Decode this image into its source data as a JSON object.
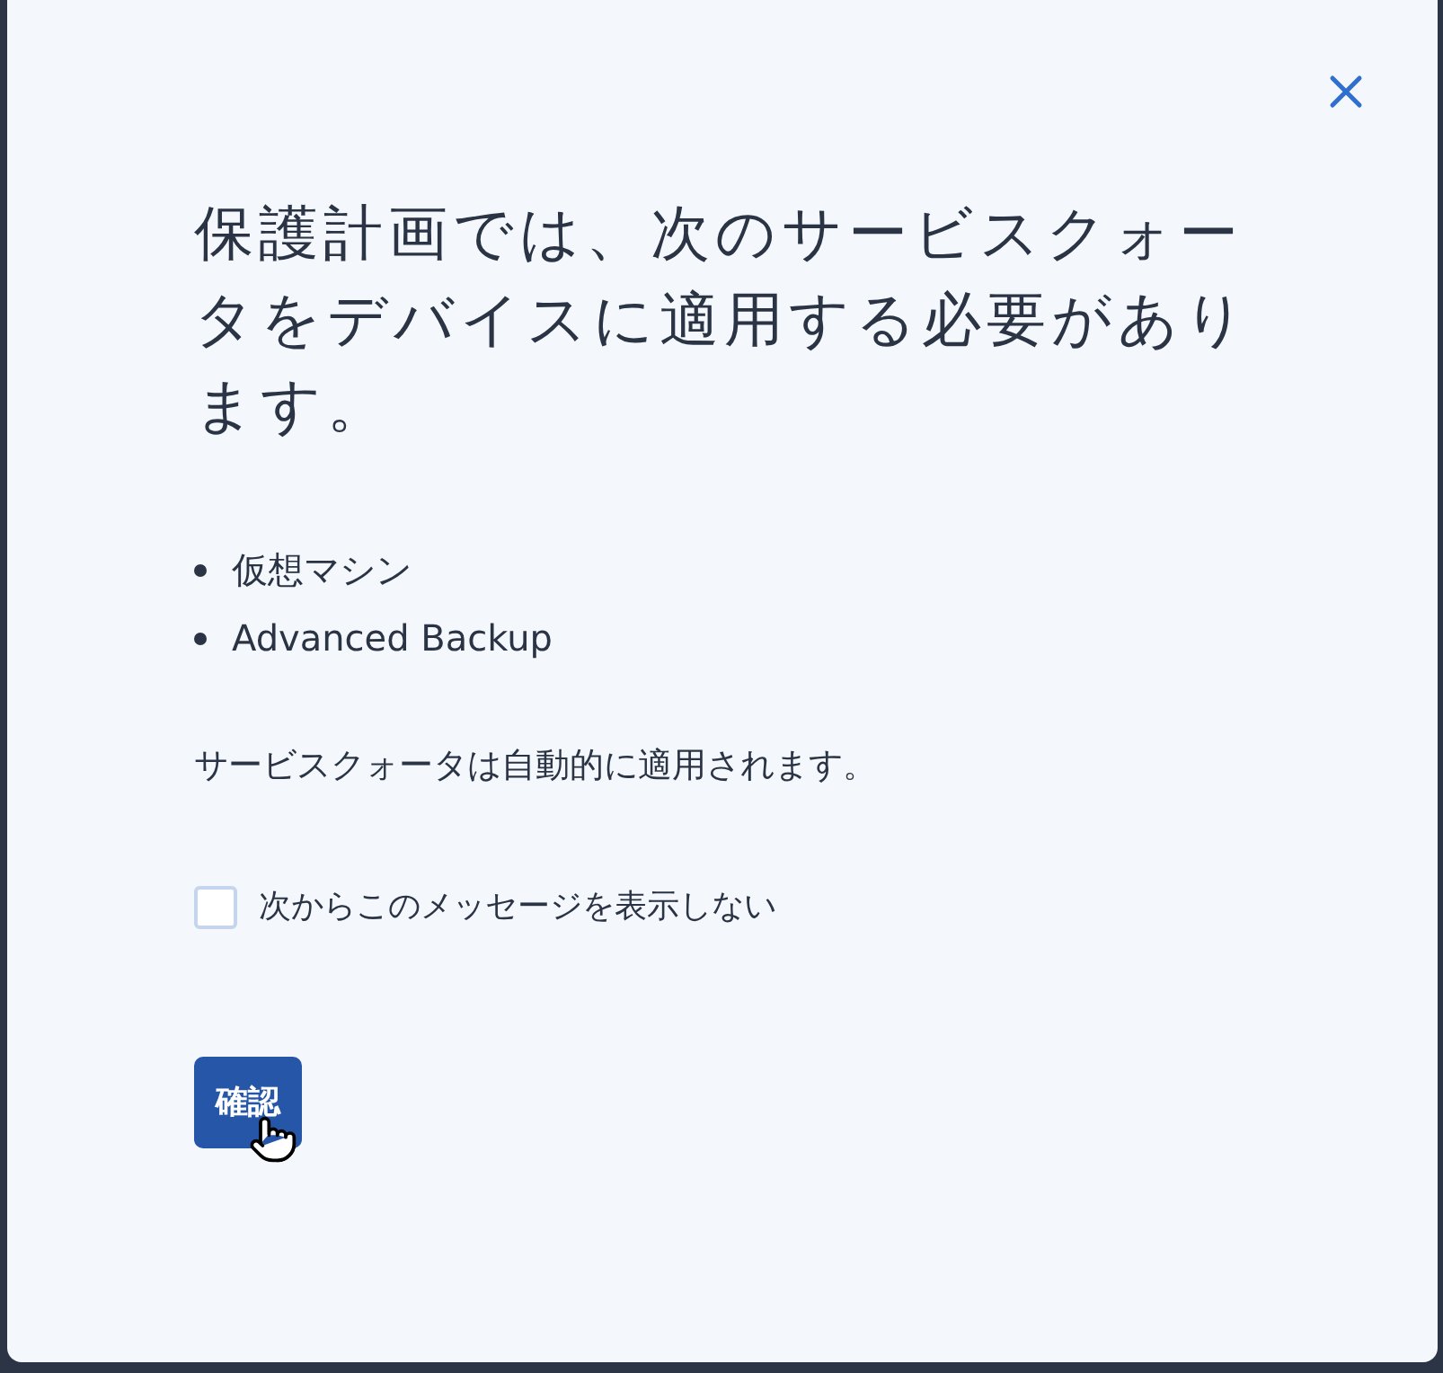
{
  "dialog": {
    "title": "保護計画では、次のサービスクォータをデバイスに適用する必要があります。",
    "items": [
      "仮想マシン",
      "Advanced Backup"
    ],
    "note": "サービスクォータは自動的に適用されます。",
    "checkbox": {
      "label": "次からこのメッセージを表示しない",
      "checked": false
    },
    "confirm_button": "確認"
  }
}
